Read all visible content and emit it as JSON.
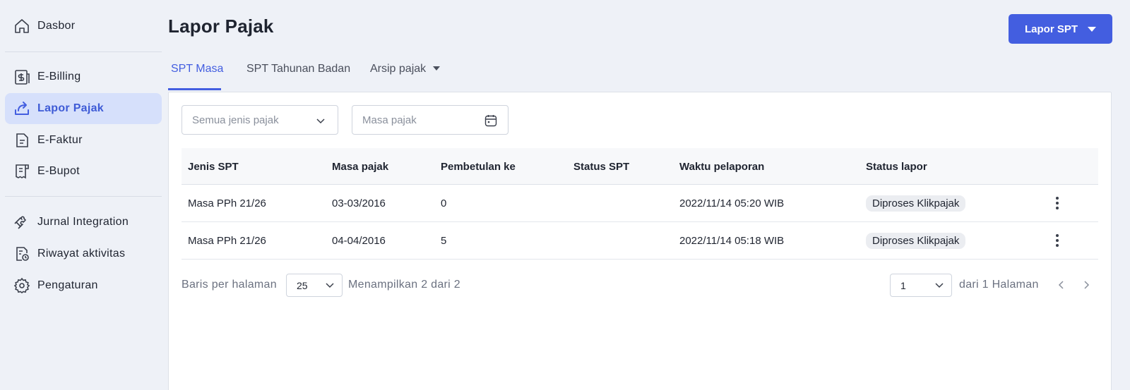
{
  "sidebar": {
    "items": [
      {
        "label": "Dasbor",
        "icon": "home-icon"
      },
      {
        "label": "E-Billing",
        "icon": "billing-icon"
      },
      {
        "label": "Lapor Pajak",
        "icon": "upload-report-icon"
      },
      {
        "label": "E-Faktur",
        "icon": "invoice-icon"
      },
      {
        "label": "E-Bupot",
        "icon": "receipt-icon"
      },
      {
        "label": "Jurnal Integration",
        "icon": "puzzle-icon"
      },
      {
        "label": "Riwayat aktivitas",
        "icon": "history-icon"
      },
      {
        "label": "Pengaturan",
        "icon": "gear-icon"
      }
    ],
    "active_item": "Lapor Pajak"
  },
  "header": {
    "title": "Lapor Pajak",
    "primary_button": "Lapor SPT"
  },
  "tabs": [
    {
      "label": "SPT Masa",
      "active": true
    },
    {
      "label": "SPT Tahunan Badan",
      "active": false
    },
    {
      "label": "Arsip pajak",
      "active": false
    }
  ],
  "filters": {
    "tax_type_placeholder": "Semua jenis pajak",
    "period_placeholder": "Masa pajak"
  },
  "table": {
    "columns": [
      "Jenis SPT",
      "Masa pajak",
      "Pembetulan ke",
      "Status SPT",
      "Waktu pelaporan",
      "Status lapor"
    ],
    "rows": [
      {
        "jenis": "Masa PPh 21/26",
        "masa": "03-03/2016",
        "pembetulan": "0",
        "status_spt": "",
        "waktu": "2022/11/14 05:20 WIB",
        "status_lapor": "Diproses Klikpajak"
      },
      {
        "jenis": "Masa PPh 21/26",
        "masa": "04-04/2016",
        "pembetulan": "5",
        "status_spt": "",
        "waktu": "2022/11/14 05:18 WIB",
        "status_lapor": "Diproses Klikpajak"
      }
    ]
  },
  "pagination": {
    "rows_label": "Baris per halaman",
    "rows_value": "25",
    "showing_text": "Menampilkan 2 dari 2",
    "page_value": "1",
    "page_total_text": "dari 1 Halaman"
  },
  "colors": {
    "accent": "#435ee0",
    "active_nav_bg": "#d6e0fb",
    "background": "#eef1f7"
  }
}
